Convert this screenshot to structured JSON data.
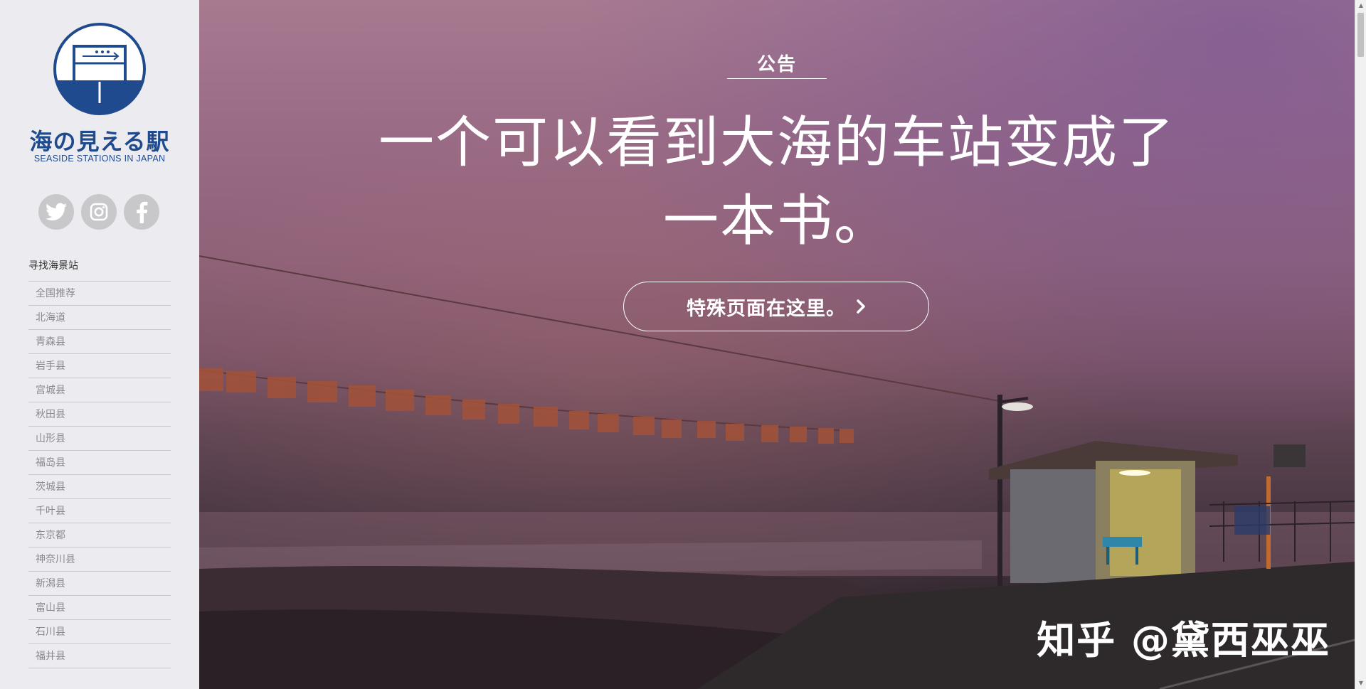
{
  "colors": {
    "brand": "#1f4b8e",
    "sidebar_bg": "#ececf0",
    "social_bg": "#c8c8cb"
  },
  "sidebar": {
    "title": "海の見える駅",
    "subtitle": "SEASIDE STATIONS IN JAPAN",
    "social": [
      {
        "icon": "twitter-icon"
      },
      {
        "icon": "instagram-icon"
      },
      {
        "icon": "facebook-icon"
      }
    ],
    "nav_heading": "寻找海景站",
    "nav_items": [
      "全国推荐",
      "北海道",
      "青森县",
      "岩手县",
      "宫城县",
      "秋田县",
      "山形县",
      "福岛县",
      "茨城县",
      "千叶县",
      "东京都",
      "神奈川县",
      "新潟县",
      "富山县",
      "石川县",
      "福井县"
    ]
  },
  "hero": {
    "notice_label": "公告",
    "headline_line1": "一个可以看到大海的车站变成了",
    "headline_line2": "一本书。",
    "cta_label": "特殊页面在这里。",
    "cta_icon": "chevron-right-icon",
    "watermark": "知乎 @黛西巫巫"
  }
}
